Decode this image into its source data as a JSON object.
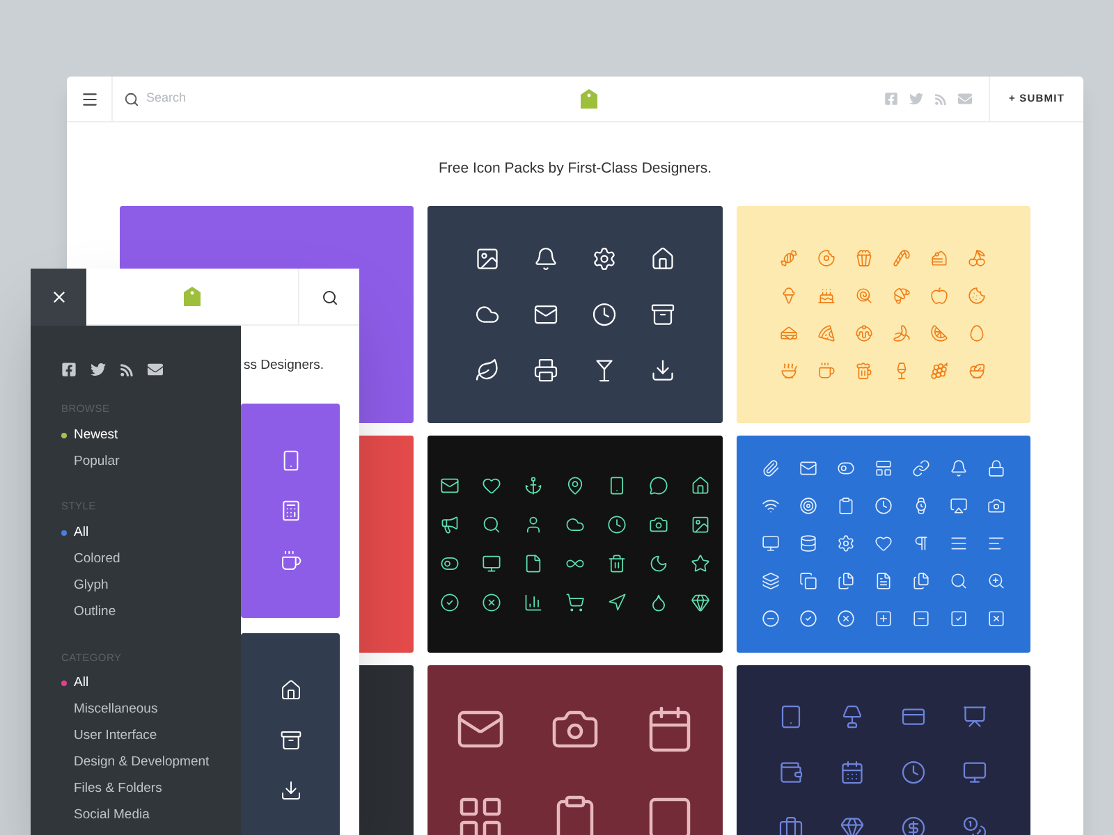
{
  "header": {
    "search": {
      "placeholder": "Search"
    },
    "submit": "+ SUBMIT"
  },
  "tagline": "Free Icon Packs by First-Class Designers.",
  "packs": [
    {
      "color": "#8e5de8"
    },
    {
      "color": "#323c4f"
    },
    {
      "color": "#fdeab0"
    },
    {
      "color": "#e54b4b"
    },
    {
      "color": "#121212"
    },
    {
      "color": "#2a72d6"
    },
    {
      "color": "#2c3035"
    },
    {
      "color": "#732b38"
    },
    {
      "color": "#242741"
    }
  ],
  "mobile": {
    "tagline": "ss Designers.",
    "packs": [
      {
        "color": "#8e5de8"
      },
      {
        "color": "#323c4f"
      }
    ],
    "sidebar": {
      "sections": [
        {
          "label": "BROWSE",
          "color": "#a6c34a",
          "items": [
            {
              "label": "Newest",
              "selected": true
            },
            {
              "label": "Popular",
              "selected": false
            }
          ]
        },
        {
          "label": "STYLE",
          "color": "#4a7fe0",
          "items": [
            {
              "label": "All",
              "selected": true
            },
            {
              "label": "Colored",
              "selected": false
            },
            {
              "label": "Glyph",
              "selected": false
            },
            {
              "label": "Outline",
              "selected": false
            }
          ]
        },
        {
          "label": "CATEGORY",
          "color": "#e0408f",
          "items": [
            {
              "label": "All",
              "selected": true
            },
            {
              "label": "Miscellaneous",
              "selected": false
            },
            {
              "label": "User Interface",
              "selected": false
            },
            {
              "label": "Design & Development",
              "selected": false
            },
            {
              "label": "Files & Folders",
              "selected": false
            },
            {
              "label": "Social Media",
              "selected": false
            }
          ]
        }
      ]
    }
  }
}
